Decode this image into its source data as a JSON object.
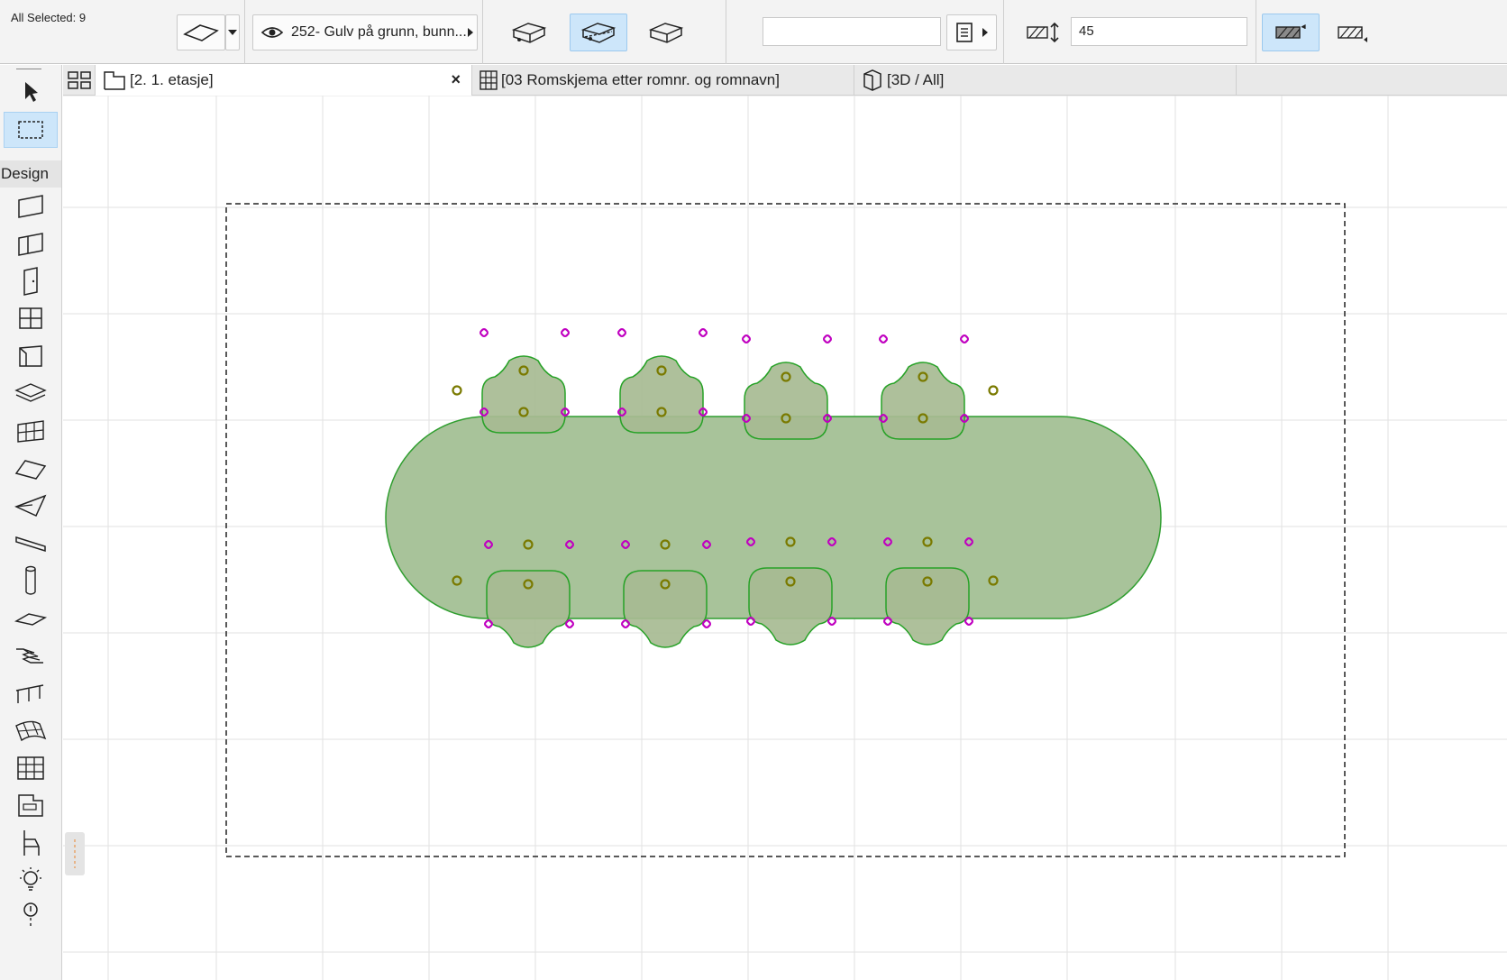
{
  "info_box": {
    "selection_label": "All Selected: 9",
    "layer_name": "252- Gulv på grunn, bunn...",
    "text_field_value": "",
    "thickness_value": "45",
    "icons": [
      "slab-icon",
      "dropdown-arrow-icon",
      "eye-icon",
      "geometry-method-icon",
      "slab-reference-icon",
      "floor-plan-display-icon",
      "document-icon",
      "thickness-icon",
      "surface-hatch-icon",
      "cut-fill-icon"
    ]
  },
  "toolbox": {
    "section_label": "Design",
    "tools": [
      "arrow",
      "marquee",
      "wall",
      "curtain-panel",
      "door",
      "window",
      "object-box",
      "slab",
      "curtain-wall",
      "roof",
      "shell",
      "beam",
      "column",
      "slab-flat",
      "stair",
      "railing",
      "mesh",
      "grid",
      "zone",
      "object-chair",
      "lamp",
      "more"
    ]
  },
  "tabs": [
    {
      "label": "[2. 1. etasje]",
      "icon": "floor-plan-icon",
      "active": true
    },
    {
      "label": "[03 Romskjema etter romnr. og romnavn]",
      "icon": "schedule-icon",
      "active": false
    },
    {
      "label": "[3D / All]",
      "icon": "3d-view-icon",
      "active": false
    }
  ],
  "colors": {
    "table_fill": "#a8c39a",
    "table_stroke": "#2f9e2f",
    "chair_fill": "#a7bb92",
    "chair_stroke": "#27a227",
    "hotspot_olive": "#7a7a00",
    "hotspot_magenta": "#c000c0",
    "grid_line": "#e2e2e2",
    "accent_blue": "#cde6fa"
  }
}
